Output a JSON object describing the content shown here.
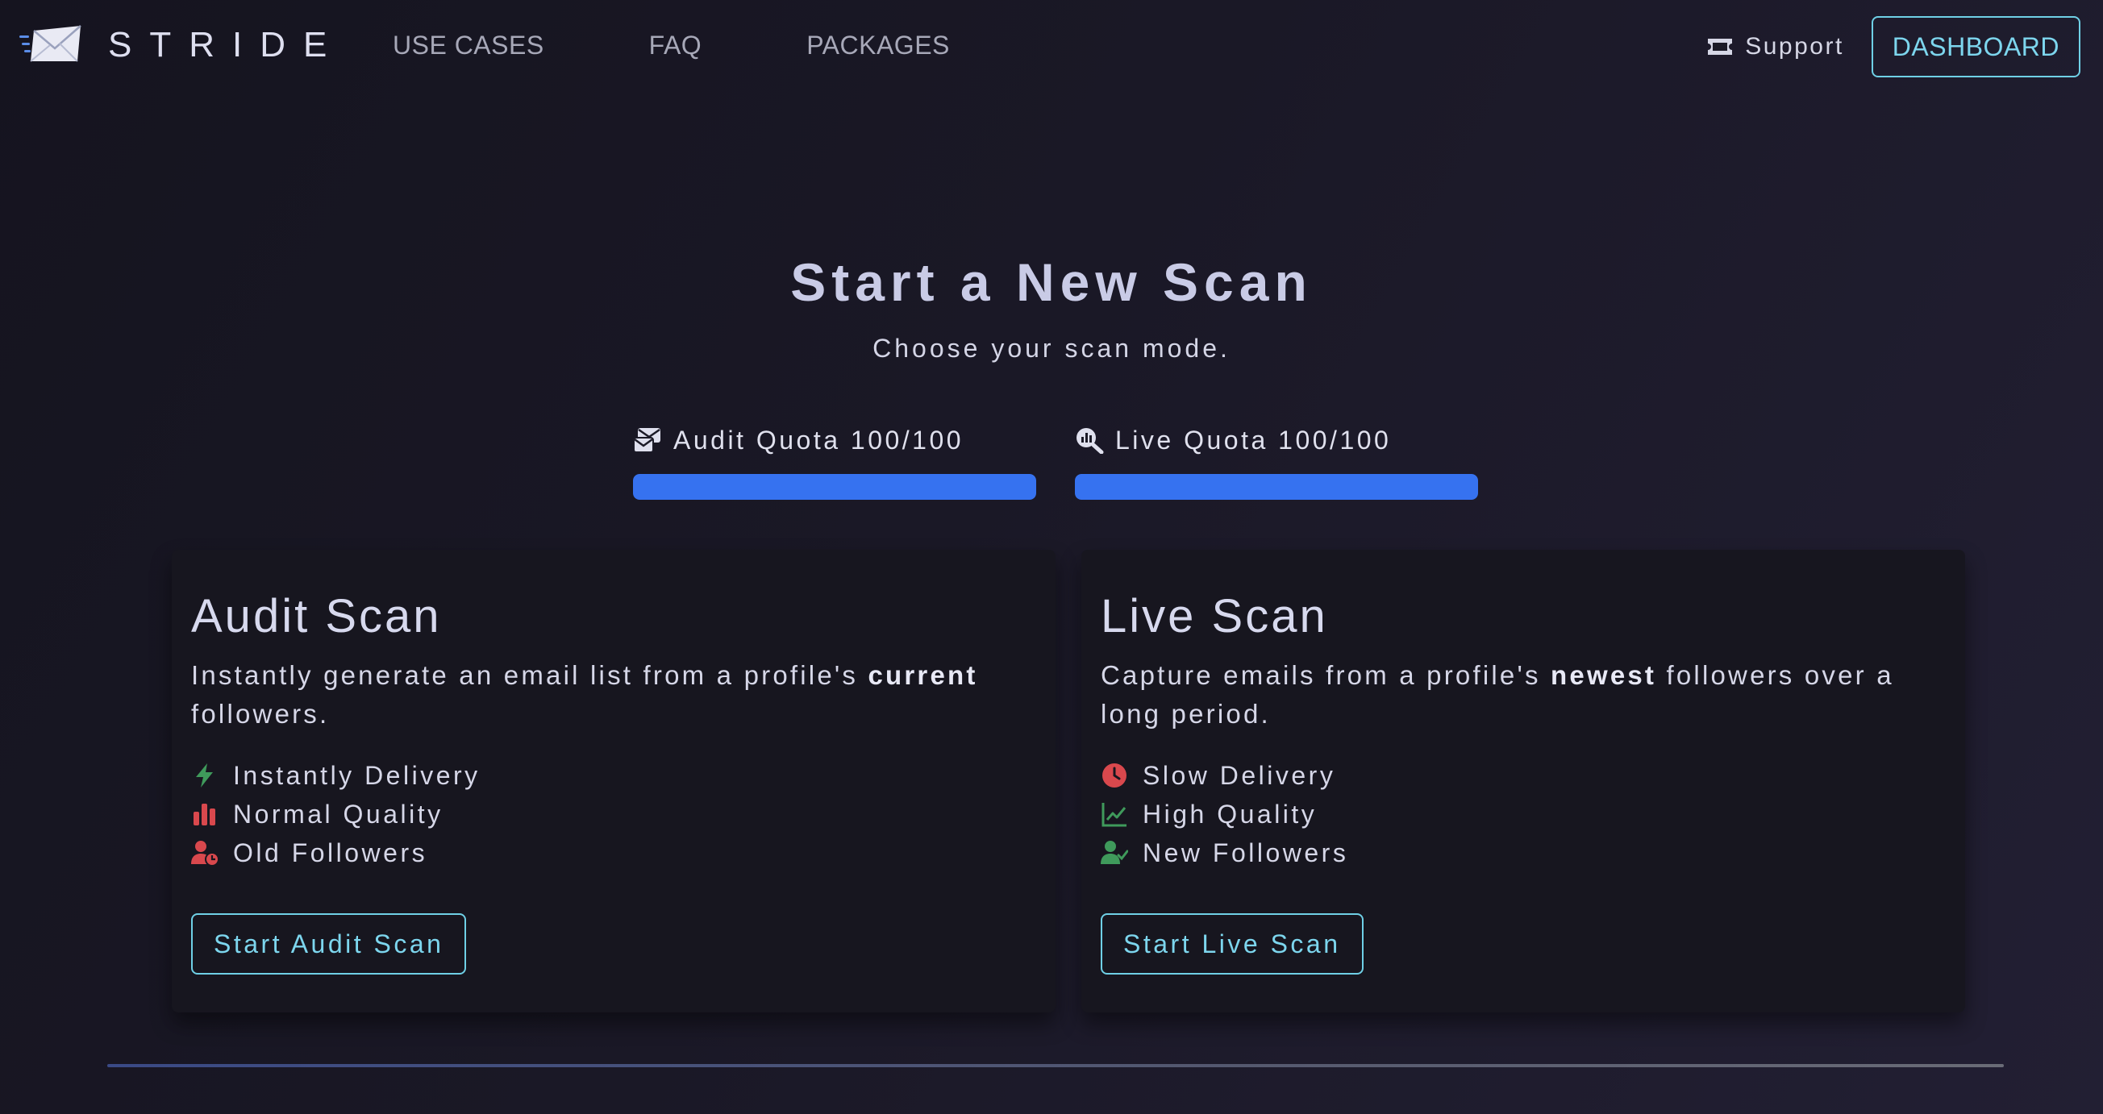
{
  "nav": {
    "brand": "STRIDE",
    "links": [
      {
        "label": "USE CASES"
      },
      {
        "label": "FAQ"
      },
      {
        "label": "PACKAGES"
      }
    ],
    "support_label": "Support",
    "dashboard_label": "DASHBOARD"
  },
  "hero": {
    "title": "Start a New Scan",
    "subtitle": "Choose your scan mode."
  },
  "quotas": [
    {
      "label": "Audit Quota 100/100",
      "used": 100,
      "total": 100,
      "icon": "envelopes-icon"
    },
    {
      "label": "Live Quota 100/100",
      "used": 100,
      "total": 100,
      "icon": "magnifier-chart-icon"
    }
  ],
  "cards": [
    {
      "title": "Audit Scan",
      "desc_before": "Instantly generate an email list from a profile's ",
      "desc_bold": "current",
      "desc_after": " followers.",
      "features": [
        {
          "label": "Instantly Delivery",
          "icon": "bolt-icon",
          "color": "#3f9a5b"
        },
        {
          "label": "Normal Quality",
          "icon": "bar-chart-icon",
          "color": "#d9484d"
        },
        {
          "label": "Old Followers",
          "icon": "user-clock-icon",
          "color": "#d9484d"
        }
      ],
      "button_label": "Start Audit Scan"
    },
    {
      "title": "Live Scan",
      "desc_before": "Capture emails from a profile's ",
      "desc_bold": "newest",
      "desc_after": " followers over a long period.",
      "features": [
        {
          "label": "Slow Delivery",
          "icon": "clock-icon",
          "color": "#d9484d"
        },
        {
          "label": "High Quality",
          "icon": "line-chart-icon",
          "color": "#3f9a5b"
        },
        {
          "label": "New Followers",
          "icon": "user-check-icon",
          "color": "#3f9a5b"
        }
      ],
      "button_label": "Start Live Scan"
    }
  ],
  "colors": {
    "accent": "#6fd0e6",
    "quota_fill": "#3672f0",
    "good": "#3f9a5b",
    "bad": "#d9484d"
  }
}
